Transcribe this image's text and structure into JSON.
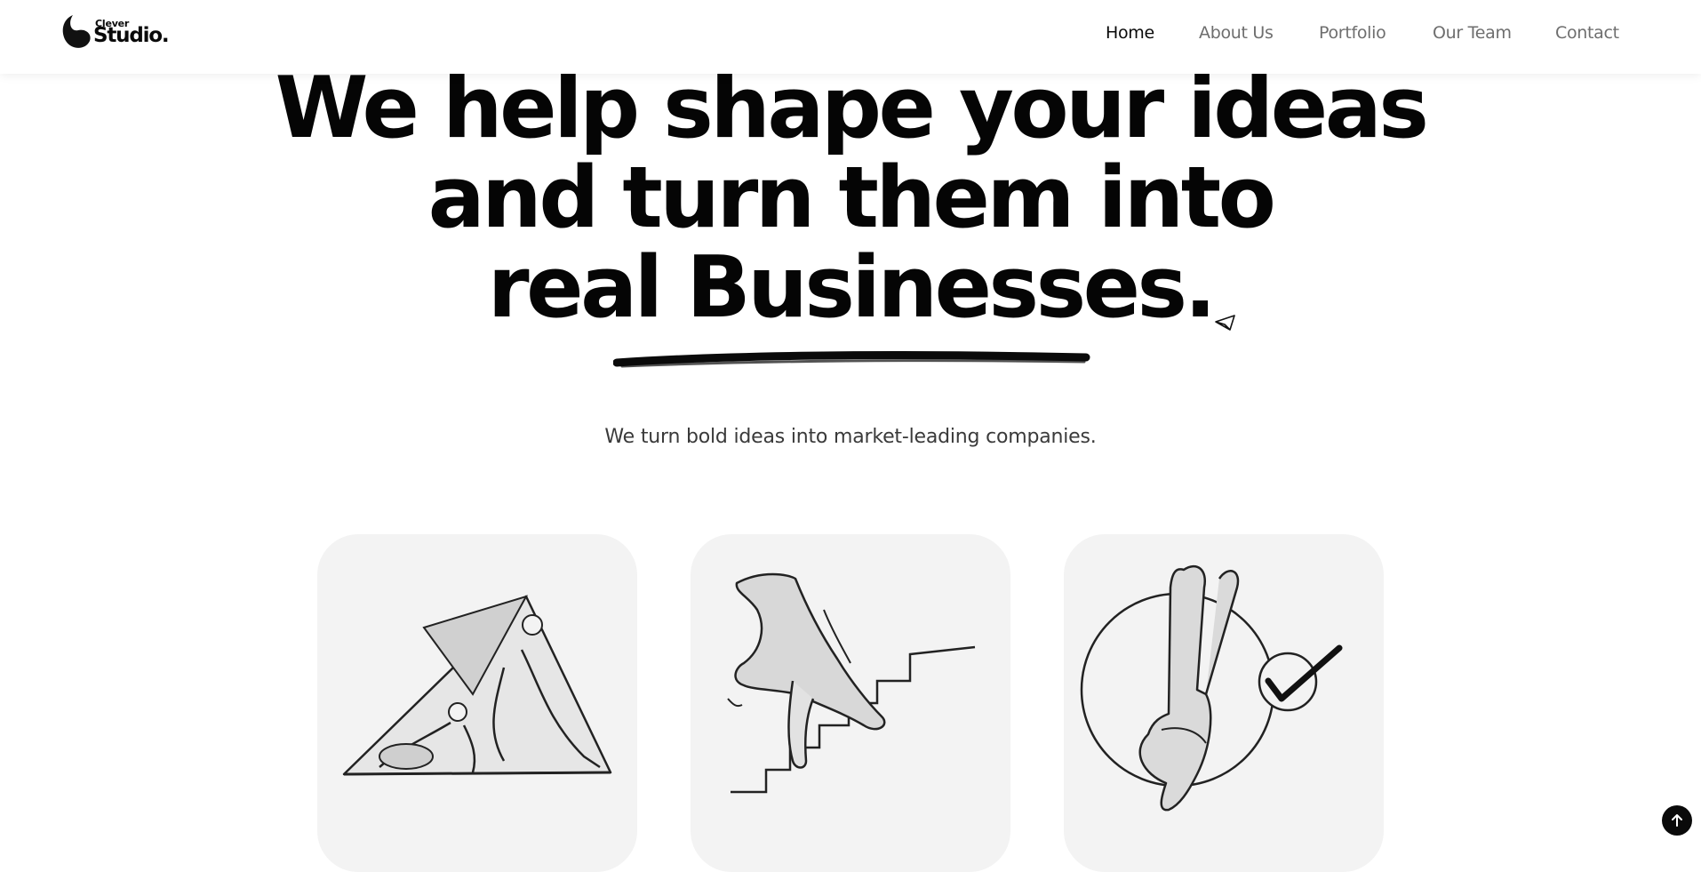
{
  "brand": {
    "small": "Clever",
    "big": "Studio."
  },
  "nav": {
    "items": [
      {
        "label": "Home",
        "active": true
      },
      {
        "label": "About Us",
        "active": false
      },
      {
        "label": "Portfolio",
        "active": false
      },
      {
        "label": "Our Team",
        "active": false
      },
      {
        "label": "Contact",
        "active": false
      }
    ]
  },
  "hero": {
    "lines": [
      "We help shape your ideas",
      "and turn them into",
      "real Businesses."
    ],
    "subtitle": "We turn bold ideas into market-leading companies."
  },
  "cards": [
    {
      "illustration": "people-lifting-triangle-illustration"
    },
    {
      "illustration": "hand-walking-stairs-illustration"
    },
    {
      "illustration": "victory-hand-checkmark-illustration"
    }
  ],
  "icons": {
    "paper_plane": "paper-plane-icon",
    "scroll_top": "arrow-up-icon"
  },
  "colors": {
    "text": "#0a0a0a",
    "nav_inactive": "#6e6e6e",
    "card_bg": "#f3f3f3",
    "page_bg": "#ffffff"
  }
}
